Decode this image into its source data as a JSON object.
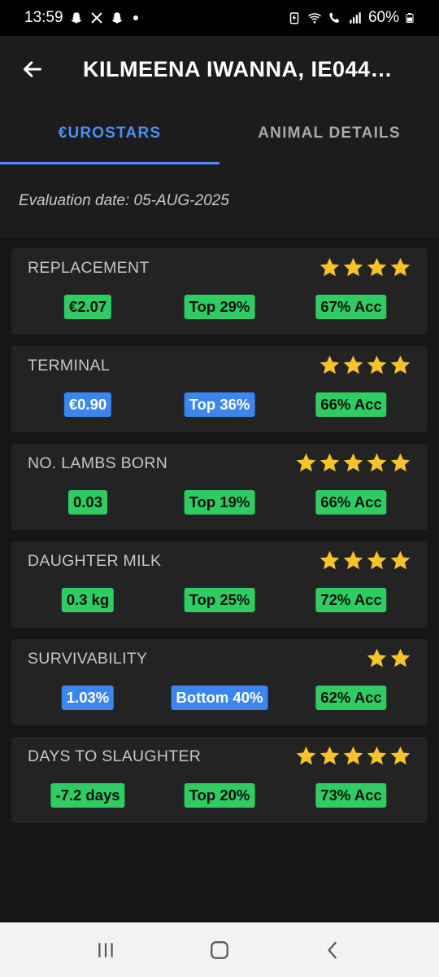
{
  "status_bar": {
    "time": "13:59",
    "battery": "60%",
    "notification_icons": [
      "snapchat-icon",
      "x-icon",
      "snapchat-icon"
    ],
    "system_icons": [
      "battery-saver-icon",
      "wifi-icon",
      "wifi-call-icon",
      "signal-icon",
      "battery-icon"
    ]
  },
  "header": {
    "title": "KILMEENA IWANNA, IE044…",
    "back_icon": "arrow-left-icon"
  },
  "tabs": [
    {
      "label": "€UROSTARS",
      "active": true
    },
    {
      "label": "ANIMAL DETAILS",
      "active": false
    }
  ],
  "evaluation_date": "Evaluation date: 05-AUG-2025",
  "colors": {
    "accent": "#4d8ef5",
    "star": "#f6c42a",
    "badge_green": "#2ecc62",
    "badge_blue": "#3d86ee"
  },
  "cards": [
    {
      "title": "REPLACEMENT",
      "stars": 4,
      "value": "€2.07",
      "value_color": "green",
      "rank": "Top 29%",
      "rank_color": "green",
      "accuracy": "67% Acc"
    },
    {
      "title": "TERMINAL",
      "stars": 4,
      "value": "€0.90",
      "value_color": "blue",
      "rank": "Top 36%",
      "rank_color": "blue",
      "accuracy": "66% Acc"
    },
    {
      "title": "NO. LAMBS BORN",
      "stars": 5,
      "value": "0.03",
      "value_color": "green",
      "rank": "Top 19%",
      "rank_color": "green",
      "accuracy": "66% Acc"
    },
    {
      "title": "DAUGHTER MILK",
      "stars": 4,
      "value": "0.3 kg",
      "value_color": "green",
      "rank": "Top 25%",
      "rank_color": "green",
      "accuracy": "72% Acc"
    },
    {
      "title": "SURVIVABILITY",
      "stars": 2,
      "value": "1.03%",
      "value_color": "blue",
      "rank": "Bottom 40%",
      "rank_color": "blue",
      "accuracy": "62% Acc"
    },
    {
      "title": "DAYS TO SLAUGHTER",
      "stars": 5,
      "value": "-7.2 days",
      "value_color": "green",
      "rank": "Top 20%",
      "rank_color": "green",
      "accuracy": "73% Acc"
    }
  ],
  "nav_bar": {
    "buttons": [
      "recent-apps-icon",
      "home-icon",
      "back-icon"
    ]
  }
}
